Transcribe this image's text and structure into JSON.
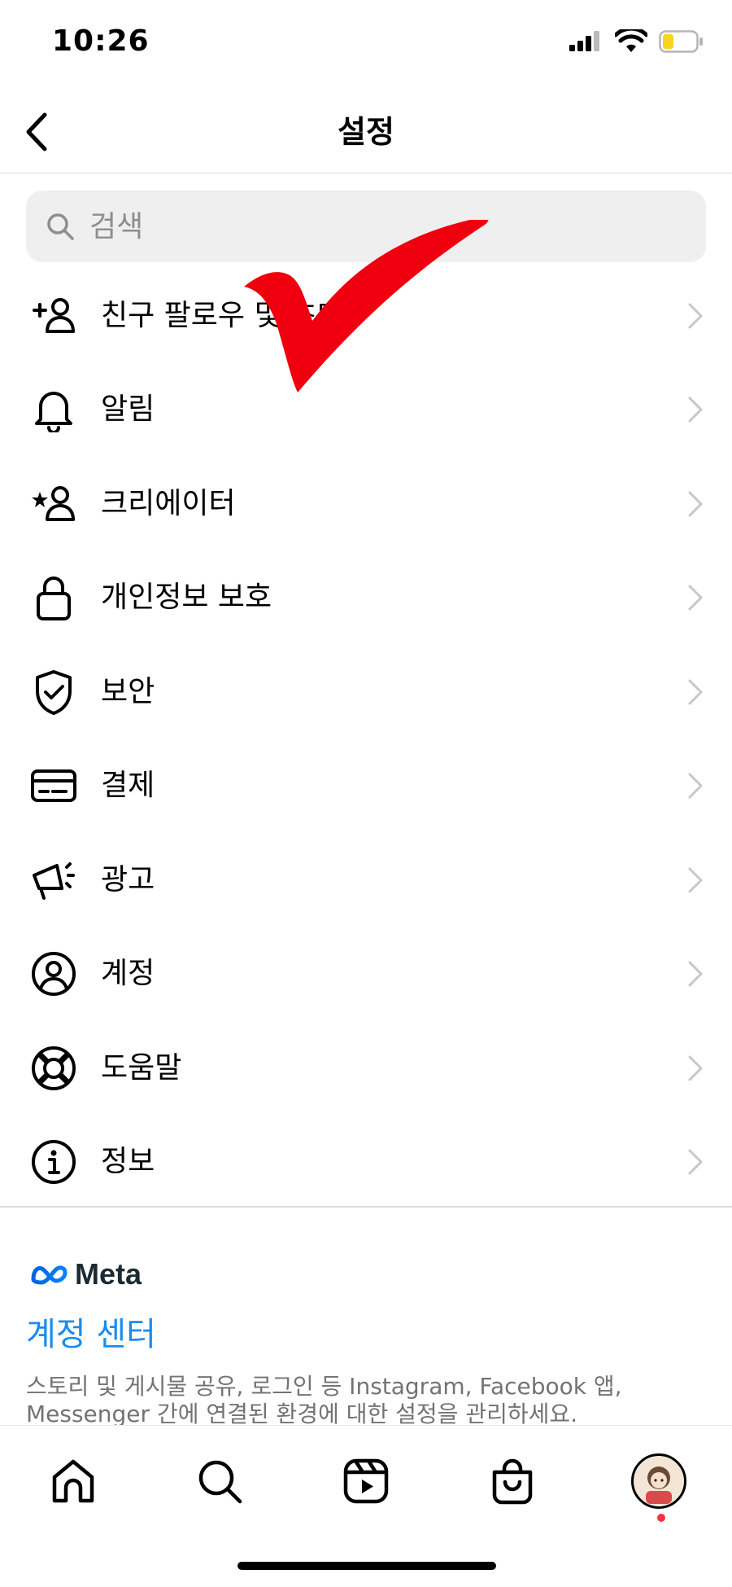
{
  "status_bar": {
    "time": "10:26",
    "battery_color": "#f7d51e"
  },
  "header": {
    "title": "설정",
    "back_icon": "chevron-left-icon"
  },
  "search": {
    "placeholder": "검색"
  },
  "menu_items": [
    {
      "label": "친구 팔로우 및 초대",
      "icon": "add-person-icon"
    },
    {
      "label": "알림",
      "icon": "bell-icon"
    },
    {
      "label": "크리에이터",
      "icon": "star-person-icon"
    },
    {
      "label": "개인정보 보호",
      "icon": "lock-icon"
    },
    {
      "label": "보안",
      "icon": "shield-check-icon"
    },
    {
      "label": "결제",
      "icon": "credit-card-icon"
    },
    {
      "label": "광고",
      "icon": "megaphone-icon"
    },
    {
      "label": "계정",
      "icon": "account-circle-icon"
    },
    {
      "label": "도움말",
      "icon": "lifebuoy-icon"
    },
    {
      "label": "정보",
      "icon": "info-icon"
    }
  ],
  "meta_section": {
    "brand": "Meta",
    "accounts_center_label": "계정 센터",
    "description": "스토리 및 게시물 공유, 로그인 등 Instagram, Facebook 앱, Messenger 간에 연결된 환경에 대한 설정을 관리하세요.",
    "link_color": "#1a8cf0"
  },
  "annotation": {
    "checkmark_color": "#f0000f"
  },
  "bottom_nav": {
    "tabs": [
      "home-icon",
      "search-icon",
      "reels-icon",
      "shop-icon",
      "profile-avatar"
    ],
    "notification_dot_color": "#ff3040"
  }
}
